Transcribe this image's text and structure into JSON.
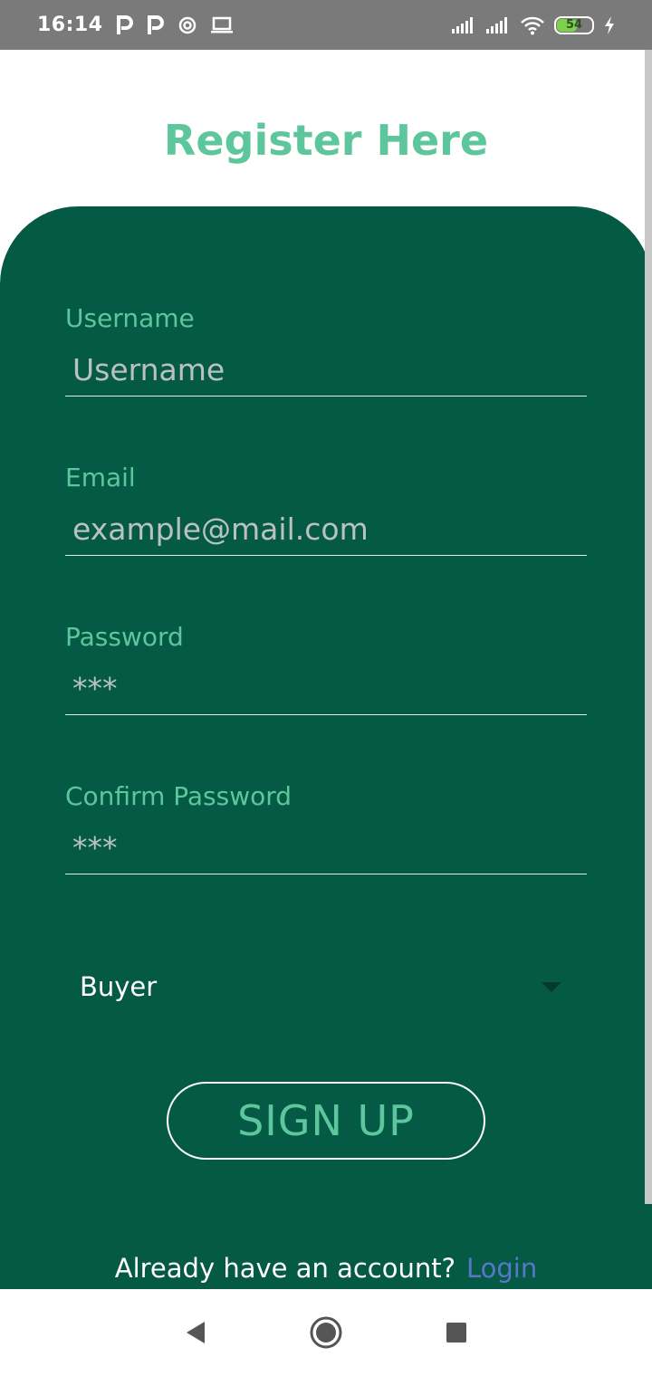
{
  "status_bar": {
    "time": "16:14",
    "left_icons": [
      "p-notification-icon",
      "p-notification-icon",
      "sync-icon",
      "laptop-icon"
    ],
    "battery_level": "54",
    "battery_fill_fraction": 0.54,
    "battery_color": "#7bd24a"
  },
  "page": {
    "title": "Register Here"
  },
  "form": {
    "username": {
      "label": "Username",
      "placeholder": "Username"
    },
    "email": {
      "label": "Email",
      "placeholder": "example@mail.com"
    },
    "password": {
      "label": "Password",
      "placeholder": "***"
    },
    "confirm_password": {
      "label": "Confirm Password",
      "placeholder": "***"
    },
    "role": {
      "selected": "Buyer"
    },
    "submit_label": "SIGN UP"
  },
  "footer": {
    "prompt": "Already have an account?",
    "login_link": "Login"
  },
  "colors": {
    "card_background": "#055a46",
    "accent_green": "#5ec69c",
    "link_blue": "#5a76c6"
  }
}
